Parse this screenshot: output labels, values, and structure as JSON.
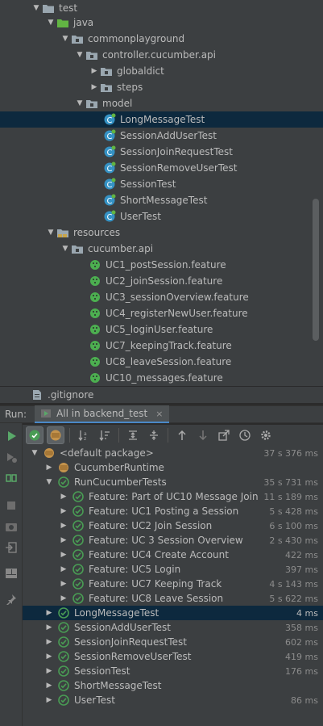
{
  "project_tree": {
    "items": [
      {
        "label": "test",
        "kind": "folder",
        "expanded": true
      },
      {
        "label": "java",
        "kind": "src-folder",
        "expanded": true
      },
      {
        "label": "commonplayground",
        "kind": "package",
        "expanded": true
      },
      {
        "label": "controller.cucumber.api",
        "kind": "package",
        "expanded": true
      },
      {
        "label": "globaldict",
        "kind": "package",
        "expanded": false
      },
      {
        "label": "steps",
        "kind": "package",
        "expanded": false
      },
      {
        "label": "model",
        "kind": "package",
        "expanded": true
      },
      {
        "label": "LongMessageTest",
        "kind": "class",
        "selected": true
      },
      {
        "label": "SessionAddUserTest",
        "kind": "class"
      },
      {
        "label": "SessionJoinRequestTest",
        "kind": "class"
      },
      {
        "label": "SessionRemoveUserTest",
        "kind": "class"
      },
      {
        "label": "SessionTest",
        "kind": "class"
      },
      {
        "label": "ShortMessageTest",
        "kind": "class"
      },
      {
        "label": "UserTest",
        "kind": "class"
      },
      {
        "label": "resources",
        "kind": "res-folder",
        "expanded": true
      },
      {
        "label": "cucumber.api",
        "kind": "package",
        "expanded": true
      },
      {
        "label": "UC1_postSession.feature",
        "kind": "feature"
      },
      {
        "label": "UC2_joinSession.feature",
        "kind": "feature"
      },
      {
        "label": "UC3_sessionOverview.feature",
        "kind": "feature"
      },
      {
        "label": "UC4_registerNewUser.feature",
        "kind": "feature"
      },
      {
        "label": "UC5_loginUser.feature",
        "kind": "feature"
      },
      {
        "label": "UC7_keepingTrack.feature",
        "kind": "feature"
      },
      {
        "label": "UC8_leaveSession.feature",
        "kind": "feature"
      },
      {
        "label": "UC10_messages.feature",
        "kind": "feature"
      }
    ],
    "gitignore_label": ".gitignore"
  },
  "run_panel": {
    "run_label": "Run:",
    "tab_label": "All in backend_test",
    "tab_close": "×"
  },
  "results": [
    {
      "label": "<default package>",
      "time": "37 s 376 ms",
      "icon": "package-icon",
      "expanded": true
    },
    {
      "label": "CucumberRuntime",
      "time": "",
      "icon": "package-icon",
      "expanded": false
    },
    {
      "label": "RunCucumberTests",
      "time": "35 s 731 ms",
      "icon": "passed-icon",
      "expanded": true
    },
    {
      "label": "Feature: Part of UC10 Message Join",
      "time": "11 s 189 ms",
      "icon": "passed-icon",
      "expanded": false
    },
    {
      "label": "Feature: UC1 Posting a Session",
      "time": "5 s 428 ms",
      "icon": "passed-icon",
      "expanded": false
    },
    {
      "label": "Feature: UC2 Join Session",
      "time": "6 s 100 ms",
      "icon": "passed-icon",
      "expanded": false
    },
    {
      "label": "Feature: UC 3 Session Overview",
      "time": "2 s 430 ms",
      "icon": "passed-icon",
      "expanded": false
    },
    {
      "label": "Feature: UC4 Create Account",
      "time": "422 ms",
      "icon": "passed-icon",
      "expanded": false
    },
    {
      "label": "Feature: UC5 Login",
      "time": "397 ms",
      "icon": "passed-icon",
      "expanded": false
    },
    {
      "label": "Feature: UC7 Keeping Track",
      "time": "4 s 143 ms",
      "icon": "passed-icon",
      "expanded": false
    },
    {
      "label": "Feature: UC8 Leave Session",
      "time": "5 s 622 ms",
      "icon": "passed-icon",
      "expanded": false
    },
    {
      "label": "LongMessageTest",
      "time": "4 ms",
      "icon": "passed-icon",
      "expanded": false,
      "selected": true
    },
    {
      "label": "SessionAddUserTest",
      "time": "358 ms",
      "icon": "passed-icon",
      "expanded": false
    },
    {
      "label": "SessionJoinRequestTest",
      "time": "602 ms",
      "icon": "passed-icon",
      "expanded": false
    },
    {
      "label": "SessionRemoveUserTest",
      "time": "419 ms",
      "icon": "passed-icon",
      "expanded": false
    },
    {
      "label": "SessionTest",
      "time": "176 ms",
      "icon": "passed-icon",
      "expanded": false
    },
    {
      "label": "ShortMessageTest",
      "time": "",
      "icon": "passed-icon",
      "expanded": false
    },
    {
      "label": "UserTest",
      "time": "86 ms",
      "icon": "passed-icon",
      "expanded": false
    }
  ],
  "colors": {
    "panel_bg": "#3c3f41",
    "selection": "#0d293e",
    "passed_green": "#499c54",
    "folder_gray": "#9aa7b0",
    "class_blue": "#3592c4",
    "run_green": "#59a869"
  }
}
